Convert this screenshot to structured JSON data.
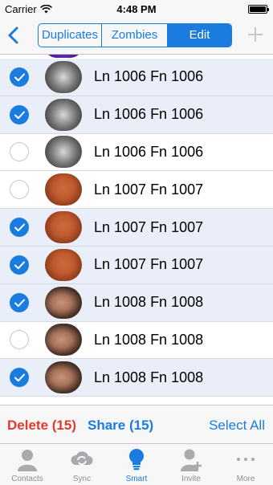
{
  "status_bar": {
    "carrier": "Carrier",
    "time": "4:48 PM"
  },
  "nav": {
    "segments": [
      "Duplicates",
      "Zombies",
      "Edit"
    ],
    "active_segment": "Edit",
    "accent_color": "#1b7ce0"
  },
  "rows": [
    {
      "name": "Ln 1006 Fn 1006",
      "selected": true,
      "avatar": "gray-object"
    },
    {
      "name": "Ln 1006 Fn 1006",
      "selected": true,
      "avatar": "gray-object"
    },
    {
      "name": "Ln 1006 Fn 1006",
      "selected": false,
      "avatar": "gray-object"
    },
    {
      "name": "Ln 1007 Fn 1007",
      "selected": false,
      "avatar": "orange-object"
    },
    {
      "name": "Ln 1007 Fn 1007",
      "selected": true,
      "avatar": "orange-object"
    },
    {
      "name": "Ln 1007 Fn 1007",
      "selected": true,
      "avatar": "orange-object"
    },
    {
      "name": "Ln 1008 Fn 1008",
      "selected": true,
      "avatar": "face-photo"
    },
    {
      "name": "Ln 1008 Fn 1008",
      "selected": false,
      "avatar": "face-photo"
    },
    {
      "name": "Ln 1008 Fn 1008",
      "selected": true,
      "avatar": "face-photo"
    }
  ],
  "actions": {
    "delete_label": "Delete (15)",
    "share_label": "Share (15)",
    "select_all_label": "Select All",
    "delete_color": "#e03b2c"
  },
  "tabs": [
    {
      "label": "Contacts",
      "icon": "person-icon",
      "active": false
    },
    {
      "label": "Sync",
      "icon": "sync-cloud-icon",
      "active": false
    },
    {
      "label": "Smart",
      "icon": "lightbulb-icon",
      "active": true
    },
    {
      "label": "Invite",
      "icon": "add-person-icon",
      "active": false
    },
    {
      "label": "More",
      "icon": "more-dots-icon",
      "active": false
    }
  ]
}
